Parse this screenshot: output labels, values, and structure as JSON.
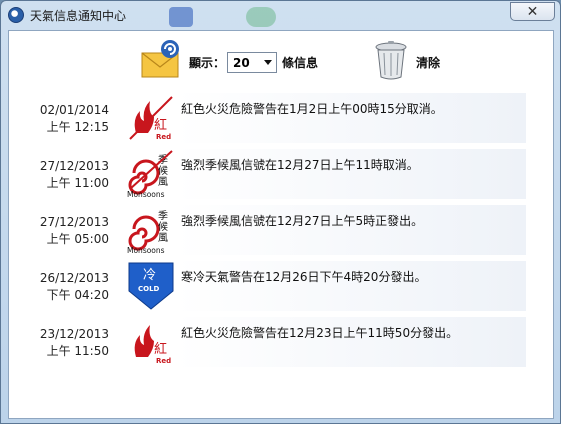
{
  "window": {
    "title": "天氣信息通知中心",
    "close_glyph": "✕"
  },
  "toolbar": {
    "show_label": "顯示：",
    "count_value": "20",
    "info_label": "條信息",
    "clear_label": "清除"
  },
  "messages": [
    {
      "date": "02/01/2014",
      "time": "上午 12:15",
      "text": "紅色火災危險警告在1月2日上午00時15分取消。",
      "icon": "red-fire-danger-cancelled-icon"
    },
    {
      "date": "27/12/2013",
      "time": "上午 11:00",
      "text": "強烈季候風信號在12月27日上午11時取消。",
      "icon": "monsoon-signal-cancelled-icon",
      "icon_label": "Monsoons"
    },
    {
      "date": "27/12/2013",
      "time": "上午 05:00",
      "text": "強烈季候風信號在12月27日上午5時正發出。",
      "icon": "monsoon-signal-icon",
      "icon_label": "Monsoons"
    },
    {
      "date": "26/12/2013",
      "time": "下午 04:20",
      "text": "寒冷天氣警告在12月26日下午4時20分發出。",
      "icon": "cold-weather-icon"
    },
    {
      "date": "23/12/2013",
      "time": "上午 11:50",
      "text": "紅色火災危險警告在12月23日上午11時50分發出。",
      "icon": "red-fire-danger-icon"
    }
  ],
  "colors": {
    "fire_red": "#c8161d",
    "cold_blue": "#1f5fc9",
    "titlebar": "#cfe0f0"
  }
}
